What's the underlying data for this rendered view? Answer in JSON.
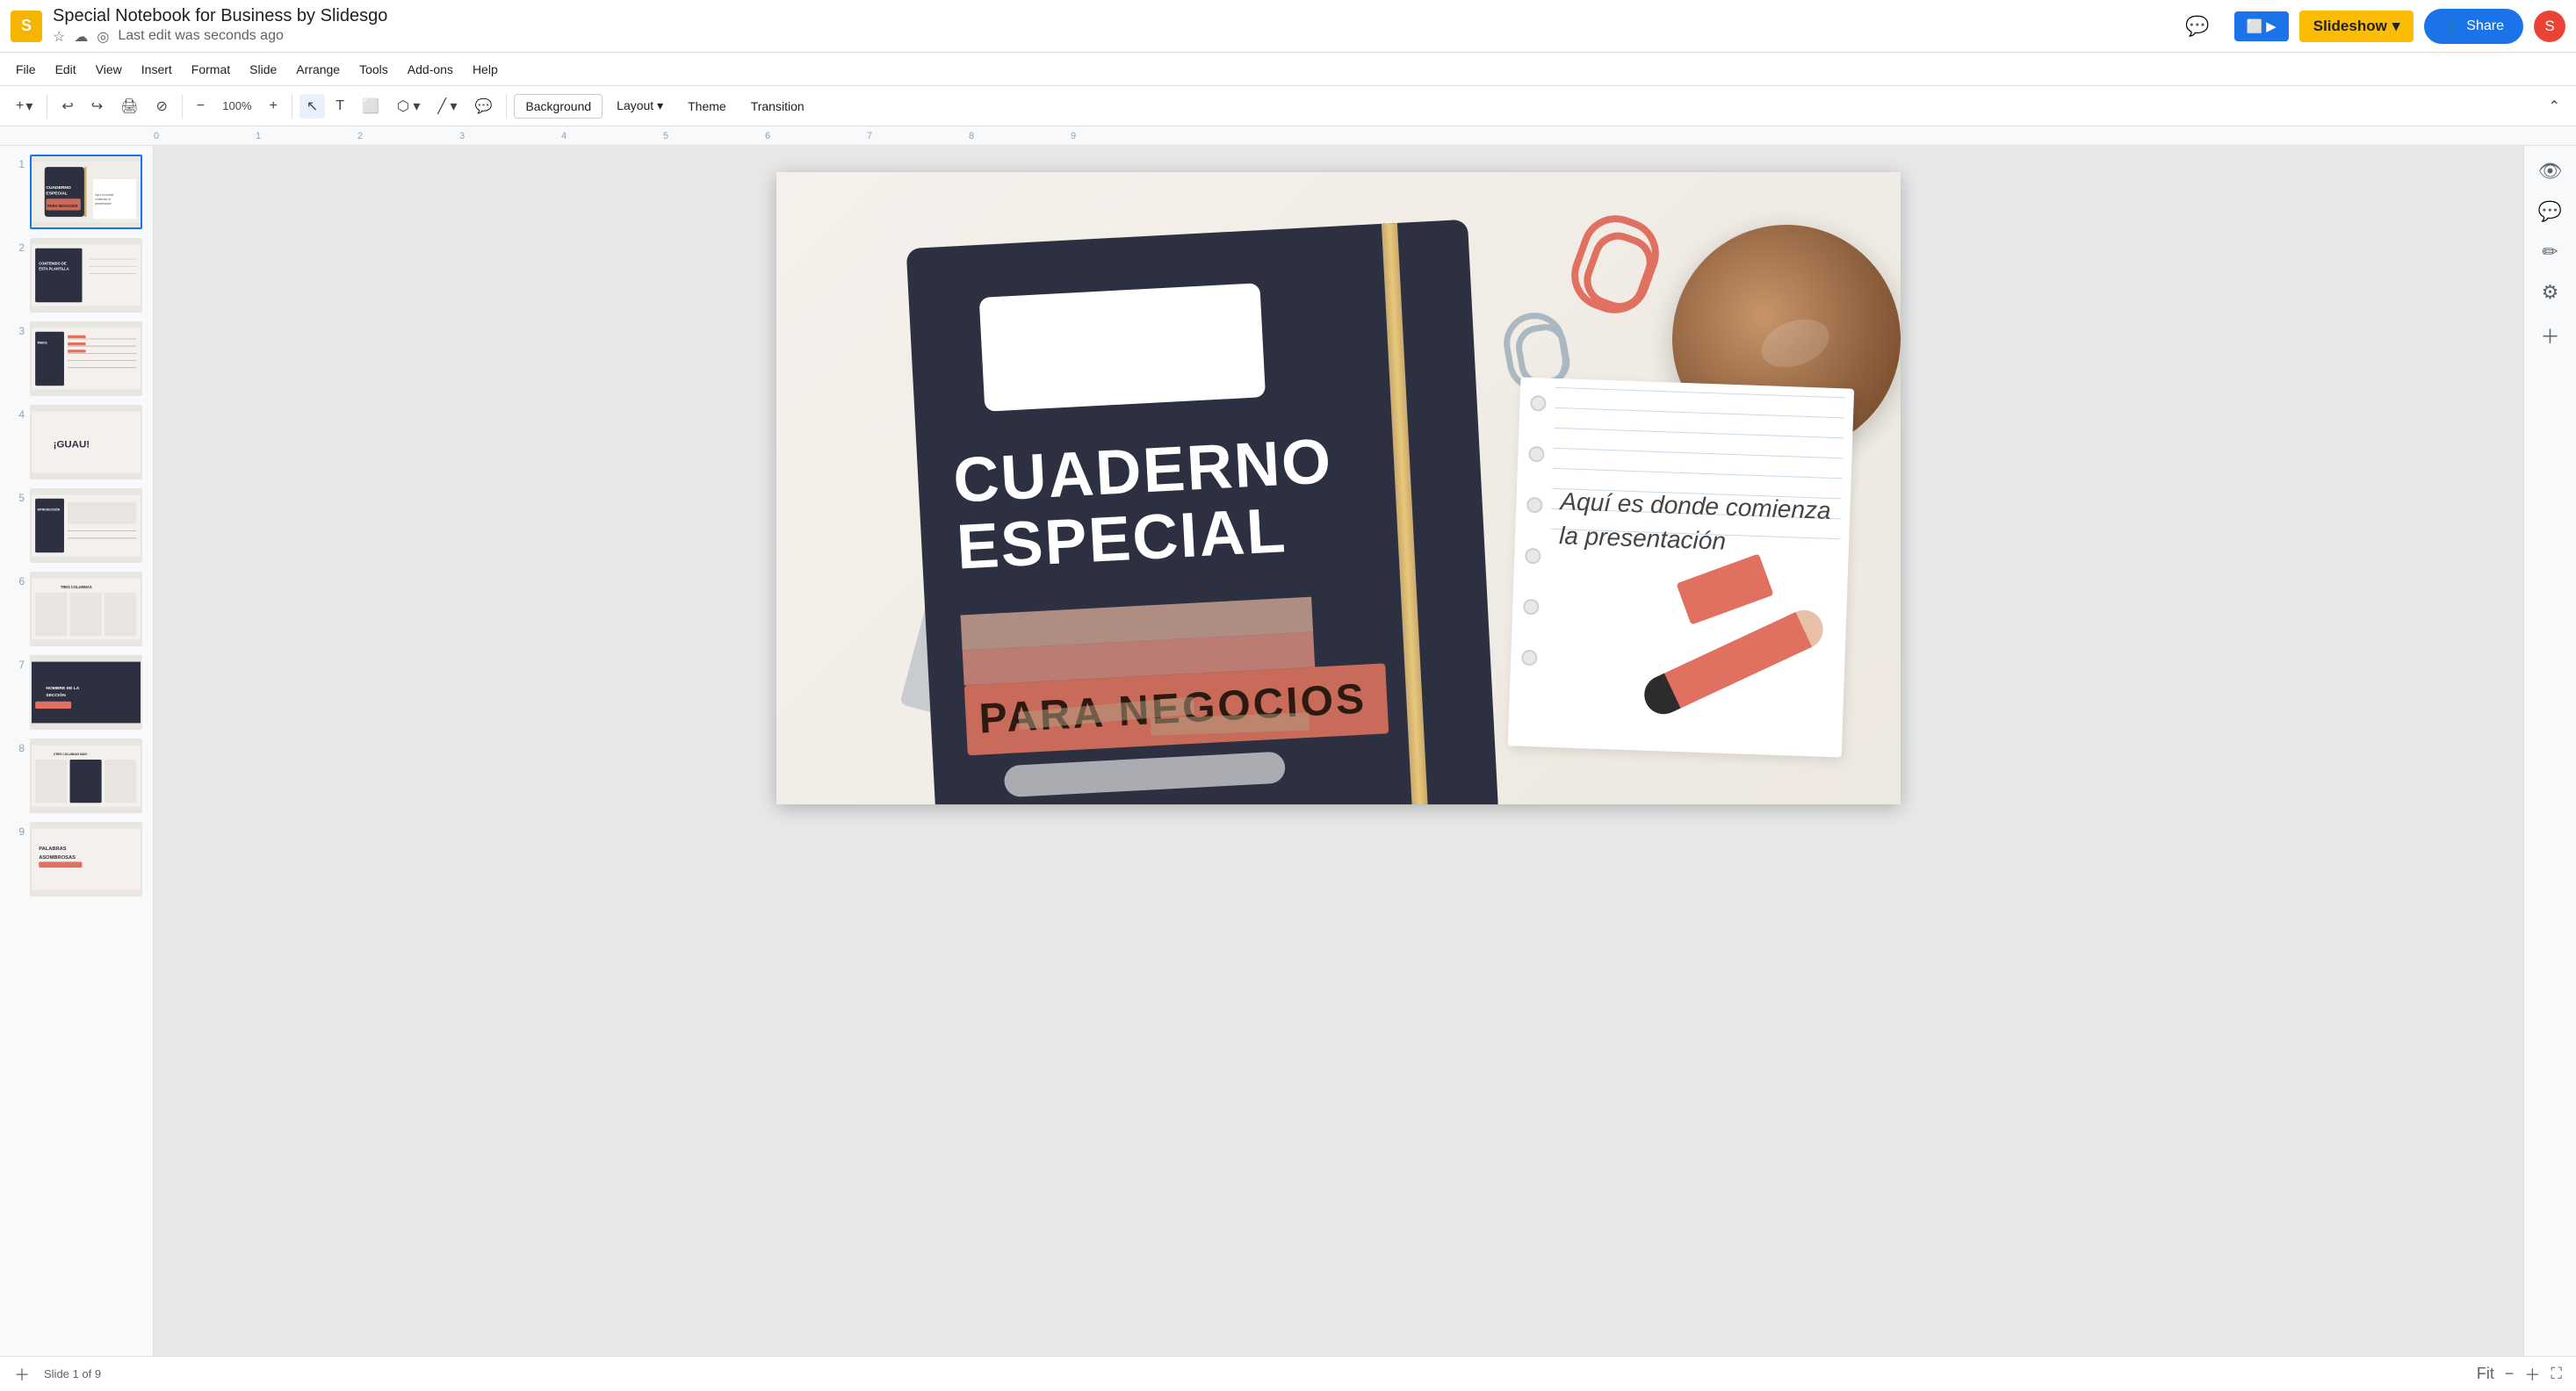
{
  "app": {
    "logo": "S",
    "title": "Special Notebook for Business by Slidesgo",
    "last_edit": "Last edit was seconds ago"
  },
  "toolbar_top": {
    "comment_icon": "💬",
    "present_label": "▶",
    "slideshow_label": "Slideshow",
    "slideshow_dropdown": "▾",
    "share_icon": "👤",
    "share_label": "Share",
    "user_avatar": "S"
  },
  "menu": {
    "items": [
      "File",
      "Edit",
      "View",
      "Insert",
      "Format",
      "Slide",
      "Arrange",
      "Tools",
      "Add-ons",
      "Help"
    ]
  },
  "toolbar": {
    "add_slide": "+",
    "undo": "↩",
    "redo": "↪",
    "print": "🖨",
    "paint_format": "⊘",
    "zoom_out": "−",
    "zoom_label": "100%",
    "zoom_in": "+",
    "select_tool": "↖",
    "text_tool": "T",
    "image_tool": "⬜",
    "shape_tool": "⬡",
    "line_tool": "/",
    "comment_tool": "💬",
    "background_label": "Background",
    "layout_label": "Layout",
    "layout_dropdown": "▾",
    "theme_label": "Theme",
    "transition_label": "Transition"
  },
  "slides": [
    {
      "num": "1",
      "label": "CUADERNO ESPECIAL PARA NEGOCIOS",
      "active": true
    },
    {
      "num": "2",
      "label": "CONTENIDO DE ESTA PLANTILLA",
      "active": false
    },
    {
      "num": "3",
      "label": "ÍNDICE",
      "active": false
    },
    {
      "num": "4",
      "label": "¡GUAU!",
      "active": false
    },
    {
      "num": "5",
      "label": "INTRODUCCIÓN",
      "active": false
    },
    {
      "num": "6",
      "label": "TRES COLUMNAS",
      "active": false
    },
    {
      "num": "7",
      "label": "NOMBRE DE LA SECCIÓN",
      "active": false
    },
    {
      "num": "8",
      "label": "¡TRES COLUMNAS MÁS!",
      "active": false
    },
    {
      "num": "9",
      "label": "PALABRAS ASOMBROSAS",
      "active": false
    }
  ],
  "slide_content": {
    "title_line1": "CUADERNO",
    "title_line2": "ESPECIAL",
    "subtitle": "PARA NEGOCIOS",
    "note_text": "Aquí es donde comienza\nla presentación"
  },
  "right_panel": {
    "icons": [
      "👁",
      "💬",
      "✏",
      "⚙",
      "+"
    ]
  },
  "bottom": {
    "slide_count": "Slide 1 of 9",
    "zoom": "Fit"
  }
}
